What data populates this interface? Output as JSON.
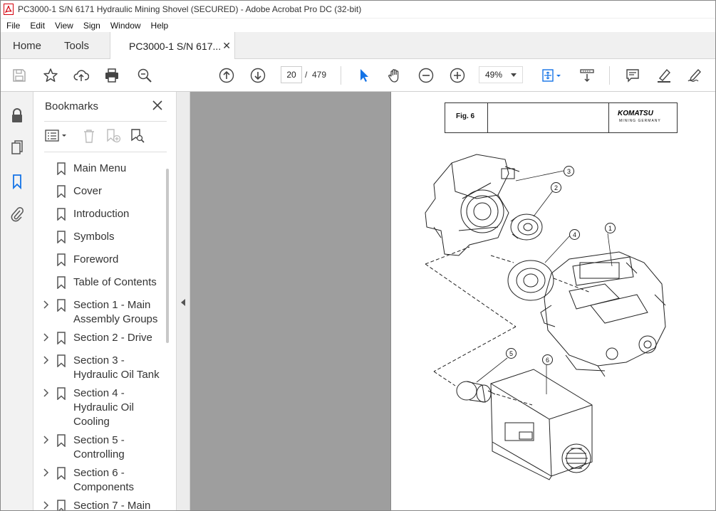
{
  "window": {
    "title": "PC3000-1 S/N 6171 Hydraulic Mining Shovel (SECURED) - Adobe Acrobat Pro DC (32-bit)"
  },
  "menubar": [
    "File",
    "Edit",
    "View",
    "Sign",
    "Window",
    "Help"
  ],
  "tabs": {
    "home": "Home",
    "tools": "Tools",
    "document": "PC3000-1 S/N 617...",
    "close_glyph": "✕"
  },
  "toolbar": {
    "current_page": "20",
    "page_separator": "/",
    "total_pages": "479",
    "zoom": "49%"
  },
  "bookmarks": {
    "header": "Bookmarks",
    "items": [
      {
        "label": "Main Menu",
        "expandable": false
      },
      {
        "label": "Cover",
        "expandable": false
      },
      {
        "label": "Introduction",
        "expandable": false
      },
      {
        "label": "Symbols",
        "expandable": false
      },
      {
        "label": "Foreword",
        "expandable": false
      },
      {
        "label": "Table of Contents",
        "expandable": false
      },
      {
        "label": "Section 1 - Main Assembly Groups",
        "expandable": true
      },
      {
        "label": "Section 2 - Drive",
        "expandable": true
      },
      {
        "label": "Section 3 - Hydraulic Oil Tank",
        "expandable": true
      },
      {
        "label": "Section 4 - Hydraulic Oil Cooling",
        "expandable": true
      },
      {
        "label": "Section 5 - Controlling",
        "expandable": true
      },
      {
        "label": "Section 6 - Components",
        "expandable": true
      },
      {
        "label": "Section 7 - Main",
        "expandable": true
      }
    ]
  },
  "document_page": {
    "figure_label": "Fig. 6",
    "brand": "KOMATSU",
    "brand_sub": "MINING GERMANY",
    "callouts": [
      "1",
      "2",
      "3",
      "4",
      "5",
      "6"
    ]
  },
  "colors": {
    "accent_blue": "#1473e6",
    "viewer_bg": "#9e9e9e",
    "acrobat_red": "#d4000c"
  }
}
